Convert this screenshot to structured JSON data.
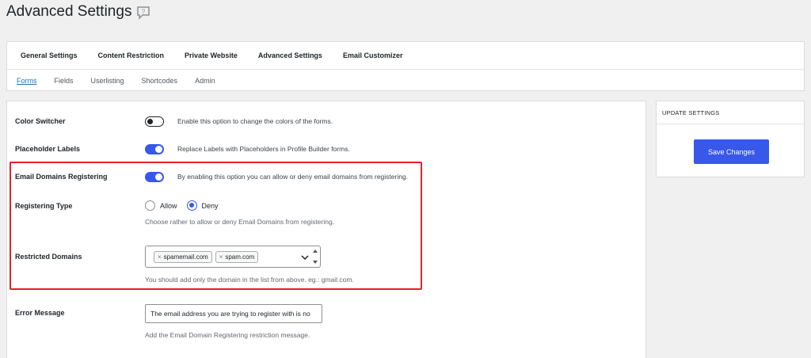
{
  "page": {
    "title": "Advanced Settings"
  },
  "main_tabs": [
    {
      "label": "General Settings"
    },
    {
      "label": "Content Restriction"
    },
    {
      "label": "Private Website"
    },
    {
      "label": "Advanced Settings"
    },
    {
      "label": "Email Customizer"
    }
  ],
  "sub_tabs": [
    {
      "label": "Forms",
      "active": true
    },
    {
      "label": "Fields"
    },
    {
      "label": "Userlisting"
    },
    {
      "label": "Shortcodes"
    },
    {
      "label": "Admin"
    }
  ],
  "settings": {
    "color_switcher": {
      "label": "Color Switcher",
      "enabled": false,
      "description": "Enable this option to change the colors of the forms."
    },
    "placeholder_labels": {
      "label": "Placeholder Labels",
      "enabled": true,
      "description": "Replace Labels with Placeholders in Profile Builder forms."
    },
    "email_domains_registering": {
      "label": "Email Domains Registering",
      "enabled": true,
      "description": "By enabling this option you can allow or deny email domains from registering."
    },
    "registering_type": {
      "label": "Registering Type",
      "options": [
        "Allow",
        "Deny"
      ],
      "selected": "Deny",
      "help": "Choose rather to allow or deny Email Domains from registering."
    },
    "restricted_domains": {
      "label": "Restricted Domains",
      "chip_remove": "×",
      "domains": [
        "spamemail.com",
        "spam.com"
      ],
      "help": "You should add only the domain in the list from above. eg.: gmail.com."
    },
    "error_message": {
      "label": "Error Message",
      "value": "The email address you are trying to register with is no",
      "help": "Add the Email Domain Registering restriction message."
    }
  },
  "sidebar": {
    "title": "UPDATE SETTINGS",
    "save_label": "Save Changes"
  },
  "colors": {
    "accent": "#3858e9",
    "link": "#2271b1",
    "highlight": "#e02424",
    "background": "#f0f0f1"
  },
  "icons": {
    "title_help": "help-speech-bubble-icon",
    "select_caret": "chevron-down-icon",
    "spinner": "up-down-arrows-icon"
  }
}
